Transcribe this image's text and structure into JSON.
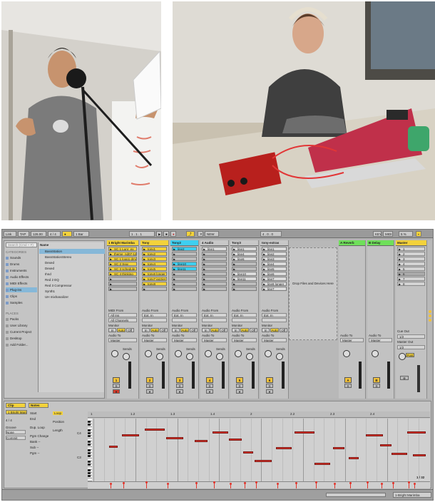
{
  "toolbar": {
    "link": "Link",
    "tap": "TAP",
    "tempo": "126.00",
    "time_sig": "4 / 4",
    "metro": "1 Bar",
    "position": "1 . 1 . 1",
    "new": "NEW",
    "key": "KEY",
    "midi": "MIDI",
    "cpu": "5 %",
    "loop": "4 . 0 . 0"
  },
  "browser": {
    "search_placeholder": "Search (Cmd + F)",
    "categories_header": "CATEGORIES",
    "categories": [
      "Sounds",
      "Drums",
      "Instruments",
      "Audio Effects",
      "MIDI Effects",
      "Plug-ins",
      "Clips",
      "Samples"
    ],
    "places_header": "PLACES",
    "places": [
      "Packs",
      "User Library",
      "Current Project",
      "Desktop",
      "Add Folder..."
    ],
    "name_header": "Name",
    "files": [
      "BassStation",
      "BassStationStereo",
      "Dexed",
      "Dexed",
      "Ihnd",
      "Red 2 EQ",
      "Red 3 Compressor",
      "Synth1",
      "UH mixhanalizer"
    ]
  },
  "tracks": [
    {
      "name": "1 Bright Marimba",
      "color": "#f3d23b",
      "clips": [
        "SC 1 Lunr_ex",
        "theme_nd07-128",
        "SC 1 loop1 dmo",
        "SC 2 Syw",
        "SC 3 schedule demo",
        "SC 4 thinking"
      ],
      "number": "1"
    },
    {
      "name": "Tony",
      "color": "#f3d23b",
      "clips": [
        "tony1",
        "tony2",
        "tony3",
        "tony4",
        "tony5",
        "tony6 longer and",
        "tony7 jazzier",
        "tony8"
      ],
      "number": "2"
    },
    {
      "name": "Tony2",
      "color": "#3ecff0",
      "clips": [
        "line2",
        "",
        "",
        "line10",
        "line11"
      ],
      "number": "3"
    },
    {
      "name": "4 Audio",
      "color": "#c8c8c8",
      "clips": [
        "line1"
      ],
      "number": "4"
    },
    {
      "name": "Tony3",
      "color": "#c8c8c8",
      "clips": [
        "line1",
        "line4",
        "line6",
        "",
        "",
        "line10",
        "line11"
      ],
      "number": "5"
    },
    {
      "name": "tony-extras",
      "color": "#c8c8c8",
      "clips": [
        "line1",
        "line2",
        "line3",
        "line4",
        "line5",
        "line6",
        "line7",
        "line8 longer",
        "line7"
      ],
      "number": "6"
    }
  ],
  "returns": [
    {
      "name": "A Reverb",
      "color": "#6fe05a",
      "letter": "A"
    },
    {
      "name": "B Delay",
      "color": "#6fe05a",
      "letter": "B"
    }
  ],
  "master": {
    "name": "Master",
    "color": "#f3d23b",
    "scenes": [
      "1",
      "2",
      "3",
      "4",
      "5",
      "6",
      "7",
      "8"
    ]
  },
  "session": {
    "drop_text": "Drop Files and Devices Here",
    "midi_from": "MIDI From",
    "audio_from": "Audio From",
    "audio_to": "Audio To",
    "monitor": "Monitor",
    "all_ins": "All Ins",
    "all_channels": "All Channels",
    "ext_in": "Ext. In",
    "in_label": "In",
    "auto_label": "Auto",
    "off_label": "Off",
    "master_label": "Master",
    "sends": "Sends",
    "post": "Post",
    "cue_out": "Cue Out",
    "master_out": "Master Out",
    "cue_value": "1/2"
  },
  "detail": {
    "clip_tab": "Clip",
    "notes_tab": "Notes",
    "clip_name": "1 Bright Marimba",
    "start": "Start",
    "end": "End",
    "loop": "Loop",
    "position": "Position",
    "length": "Length",
    "groove": "Groove",
    "none": "None",
    "signature": "4 / 4",
    "commit": "Commit",
    "pgm_change": "Pgm Change",
    "bank": "Bank --",
    "sub": "Sub --",
    "pgm": "Pgm --",
    "dup_loop": "Dup. Loop",
    "zoom": "1 / 32",
    "bar_labels": [
      "1",
      "1.2",
      "1.3",
      "1.4",
      "2",
      "2.2",
      "2.3",
      "2.4"
    ],
    "octave_labels": [
      "C4",
      "C3"
    ]
  },
  "status": {
    "track_name": "1-Bright Marimba"
  }
}
